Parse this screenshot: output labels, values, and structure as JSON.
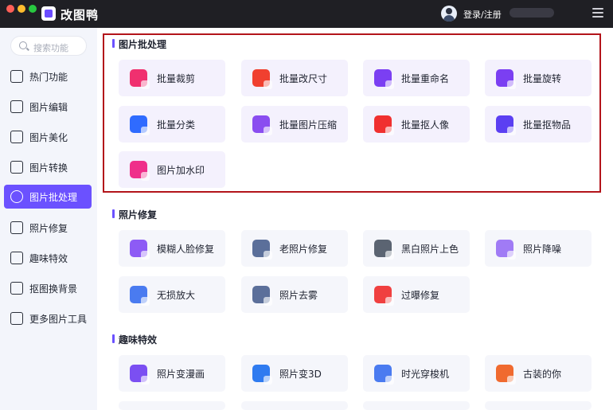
{
  "app": {
    "title": "改图鸭",
    "login_label": "登录/注册"
  },
  "sidebar": {
    "search_placeholder": "搜索功能",
    "items": [
      {
        "label": "热门功能",
        "icon": "flame-icon"
      },
      {
        "label": "图片编辑",
        "icon": "image-edit-icon"
      },
      {
        "label": "图片美化",
        "icon": "image-beautify-icon"
      },
      {
        "label": "图片转换",
        "icon": "image-convert-icon"
      },
      {
        "label": "图片批处理",
        "icon": "batch-icon",
        "active": true
      },
      {
        "label": "照片修复",
        "icon": "photo-repair-icon"
      },
      {
        "label": "趣味特效",
        "icon": "magic-icon"
      },
      {
        "label": "抠图换背景",
        "icon": "cutout-icon"
      },
      {
        "label": "更多图片工具",
        "icon": "toolbox-icon"
      }
    ]
  },
  "sections": [
    {
      "title": "图片批处理",
      "tools": [
        {
          "label": "批量裁剪",
          "color": "#f0306f"
        },
        {
          "label": "批量改尺寸",
          "color": "#f0402f"
        },
        {
          "label": "批量重命名",
          "color": "#7b3ff2"
        },
        {
          "label": "批量旋转",
          "color": "#7b3ff2"
        },
        {
          "label": "批量分类",
          "color": "#2f6bff"
        },
        {
          "label": "批量图片压缩",
          "color": "#8a4df0"
        },
        {
          "label": "批量抠人像",
          "color": "#f0302f"
        },
        {
          "label": "批量抠物品",
          "color": "#5b3ff2"
        },
        {
          "label": "图片加水印",
          "color": "#ef2f8a"
        }
      ]
    },
    {
      "title": "照片修复",
      "tools": [
        {
          "label": "模糊人脸修复",
          "color": "#8d5bf5"
        },
        {
          "label": "老照片修复",
          "color": "#5b6f9a"
        },
        {
          "label": "黑白照片上色",
          "color": "#5b6472"
        },
        {
          "label": "照片降噪",
          "color": "#a07bf5"
        },
        {
          "label": "无损放大",
          "color": "#4a7bf0"
        },
        {
          "label": "照片去雾",
          "color": "#5b6f9a"
        },
        {
          "label": "过曝修复",
          "color": "#f04040"
        }
      ]
    },
    {
      "title": "趣味特效",
      "tools": [
        {
          "label": "照片变漫画",
          "color": "#7b4ff2"
        },
        {
          "label": "照片变3D",
          "color": "#2f7bf0"
        },
        {
          "label": "时光穿梭机",
          "color": "#4a7bf0"
        },
        {
          "label": "古装的你",
          "color": "#f06a2f"
        }
      ]
    }
  ]
}
